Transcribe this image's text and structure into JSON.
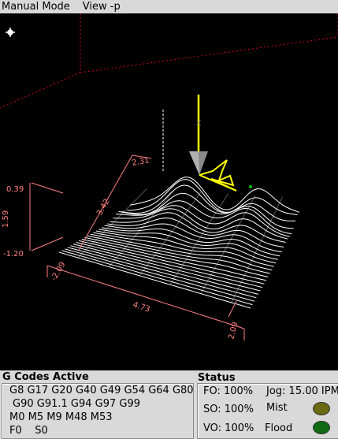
{
  "menubar": {
    "items": [
      "Manual Mode",
      "View -p"
    ]
  },
  "viewport": {
    "axis_labels": {
      "z_top": "0.39",
      "z_mid": "1.59",
      "z_low": "-1.20",
      "x_left": "-2.09",
      "x_span": "4.73",
      "x_right": "2.09",
      "y_span": "3.42",
      "y_top": "2.31"
    },
    "colors": {
      "toolpath": "#ffffff",
      "extents": "#ff8080",
      "tool": "#ffff00",
      "box": "#c8002a"
    }
  },
  "gcodes": {
    "title": "G Codes Active",
    "lines": [
      "G8 G17 G20 G40 G49 G54 G64 G80",
      "G90 G91.1 G94 G97 G99",
      "M0 M5 M9 M48 M53",
      "F0    S0"
    ]
  },
  "status": {
    "title": "Status",
    "fo": "FO: 100%",
    "so": "SO: 100%",
    "vo": "VO: 100%",
    "jog": "Jog: 15.00 IPM",
    "mist": "Mist",
    "flood": "Flood",
    "mist_color": "#6b6a12",
    "flood_color": "#0f6b14"
  }
}
